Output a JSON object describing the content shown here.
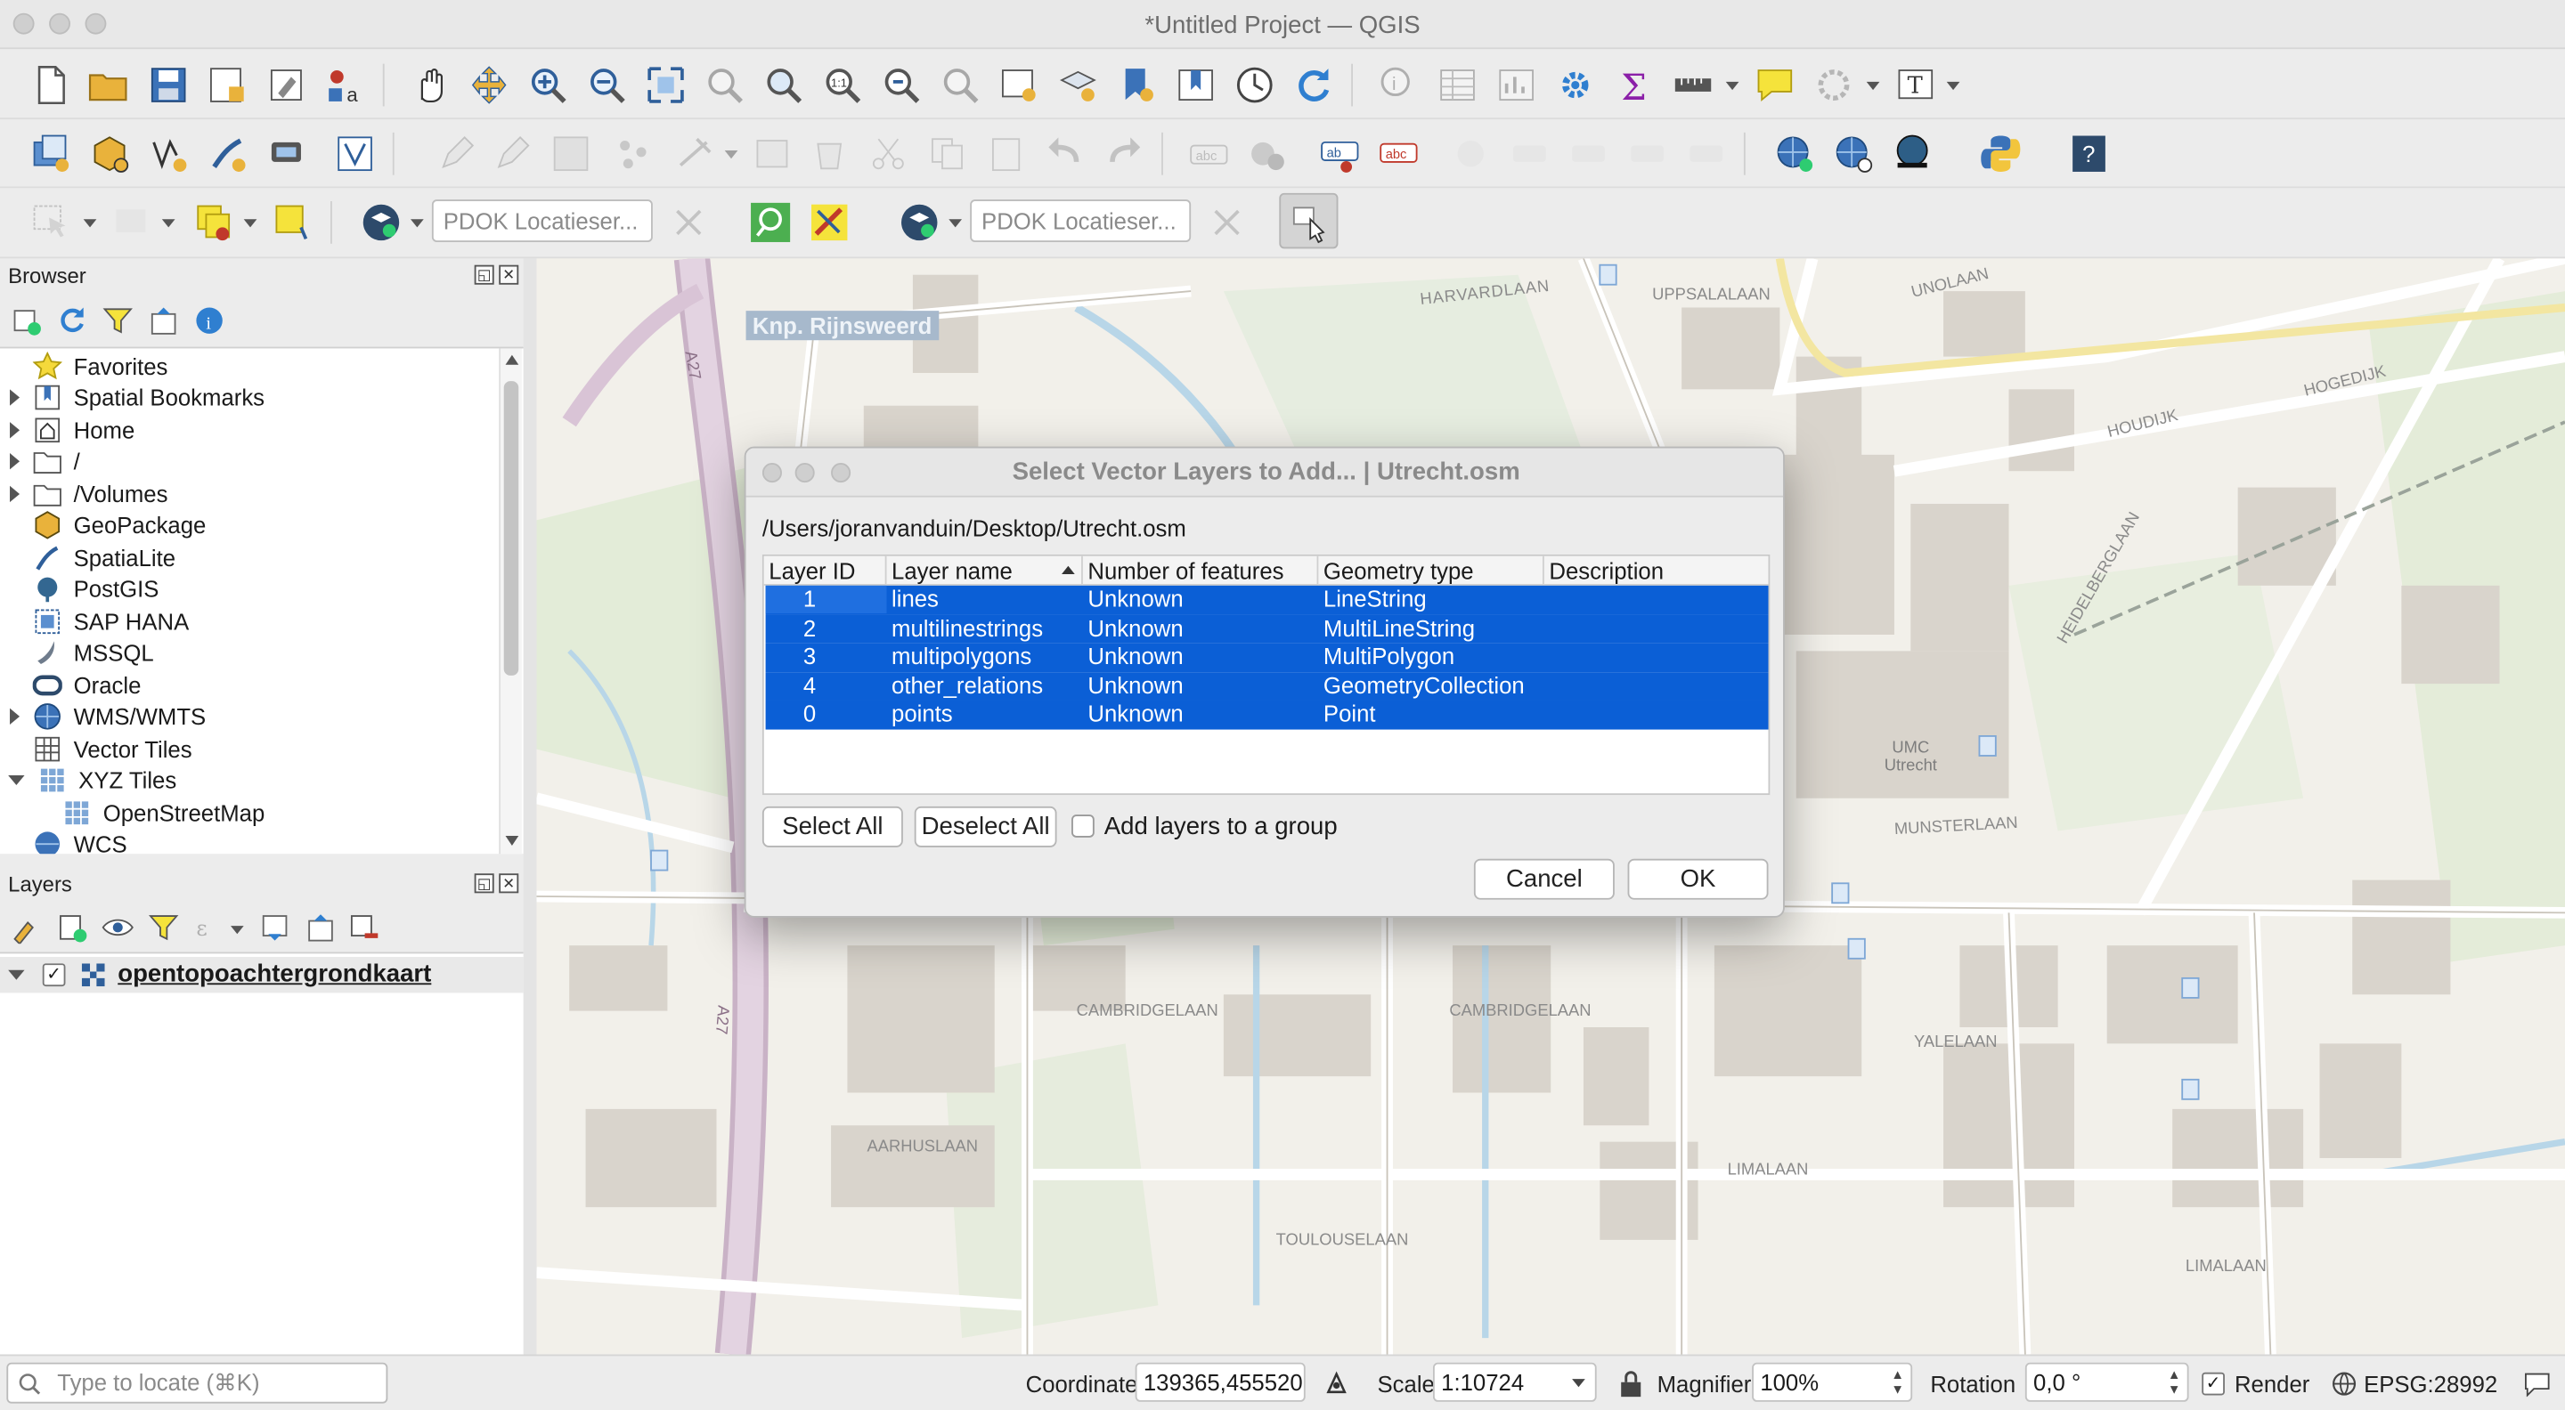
{
  "window": {
    "title": "*Untitled Project — QGIS"
  },
  "toolbar": {
    "locator_1_placeholder": "PDOK Locatieser...",
    "locator_2_placeholder": "PDOK Locatieser..."
  },
  "browser": {
    "title": "Browser",
    "items": [
      {
        "label": "Favorites"
      },
      {
        "label": "Spatial Bookmarks"
      },
      {
        "label": "Home"
      },
      {
        "label": "/"
      },
      {
        "label": "/Volumes"
      },
      {
        "label": "GeoPackage"
      },
      {
        "label": "SpatiaLite"
      },
      {
        "label": "PostGIS"
      },
      {
        "label": "SAP HANA"
      },
      {
        "label": "MSSQL"
      },
      {
        "label": "Oracle"
      },
      {
        "label": "WMS/WMTS"
      },
      {
        "label": "Vector Tiles"
      },
      {
        "label": "XYZ Tiles"
      },
      {
        "label": "OpenStreetMap"
      },
      {
        "label": "WCS"
      }
    ]
  },
  "layers": {
    "title": "Layers",
    "items": [
      {
        "label": "opentopoachtergrondkaart",
        "checked": true
      }
    ]
  },
  "map": {
    "labels": [
      "Knp. Rijnsweerd",
      "HARVARDLAAN",
      "UPPSALALAAN",
      "UNOLAAN",
      "CAMBRIDGELAAN",
      "CAMBRIDGELAAN",
      "MUNSTERLAAN",
      "YALELAAN",
      "LIMALAAN",
      "LIMALAAN",
      "TOULOUSELAAN",
      "AARHUSLAAN",
      "HEIDELBERGLAAN",
      "A27",
      "A27",
      "UMC Utrecht",
      "HOGEDIJK",
      "HOUDIJK"
    ]
  },
  "dialog": {
    "title": "Select Vector Layers to Add... | Utrecht.osm",
    "path": "/Users/joranvanduin/Desktop/Utrecht.osm",
    "columns": [
      "Layer ID",
      "Layer name",
      "Number of features",
      "Geometry type",
      "Description"
    ],
    "rows": [
      {
        "id": "1",
        "name": "lines",
        "features": "Unknown",
        "geom": "LineString",
        "desc": ""
      },
      {
        "id": "2",
        "name": "multilinestrings",
        "features": "Unknown",
        "geom": "MultiLineString",
        "desc": ""
      },
      {
        "id": "3",
        "name": "multipolygons",
        "features": "Unknown",
        "geom": "MultiPolygon",
        "desc": ""
      },
      {
        "id": "4",
        "name": "other_relations",
        "features": "Unknown",
        "geom": "GeometryCollection",
        "desc": ""
      },
      {
        "id": "0",
        "name": "points",
        "features": "Unknown",
        "geom": "Point",
        "desc": ""
      }
    ],
    "select_all": "Select All",
    "deselect_all": "Deselect All",
    "add_to_group": "Add layers to a group",
    "cancel": "Cancel",
    "ok": "OK"
  },
  "status": {
    "locate_placeholder": "Type to locate (⌘K)",
    "coordinate_label": "Coordinate",
    "coordinate_value": "139365,455520",
    "scale_label": "Scale",
    "scale_value": "1:10724",
    "magnifier_label": "Magnifier",
    "magnifier_value": "100%",
    "rotation_label": "Rotation",
    "rotation_value": "0,0 °",
    "render_label": "Render",
    "render_checked": true,
    "crs": "EPSG:28992"
  },
  "colors": {
    "selection": "#0b5fd6",
    "map_bg": "#f1efe9",
    "road": "#ffffff",
    "motorway": "#d7c6d6"
  }
}
